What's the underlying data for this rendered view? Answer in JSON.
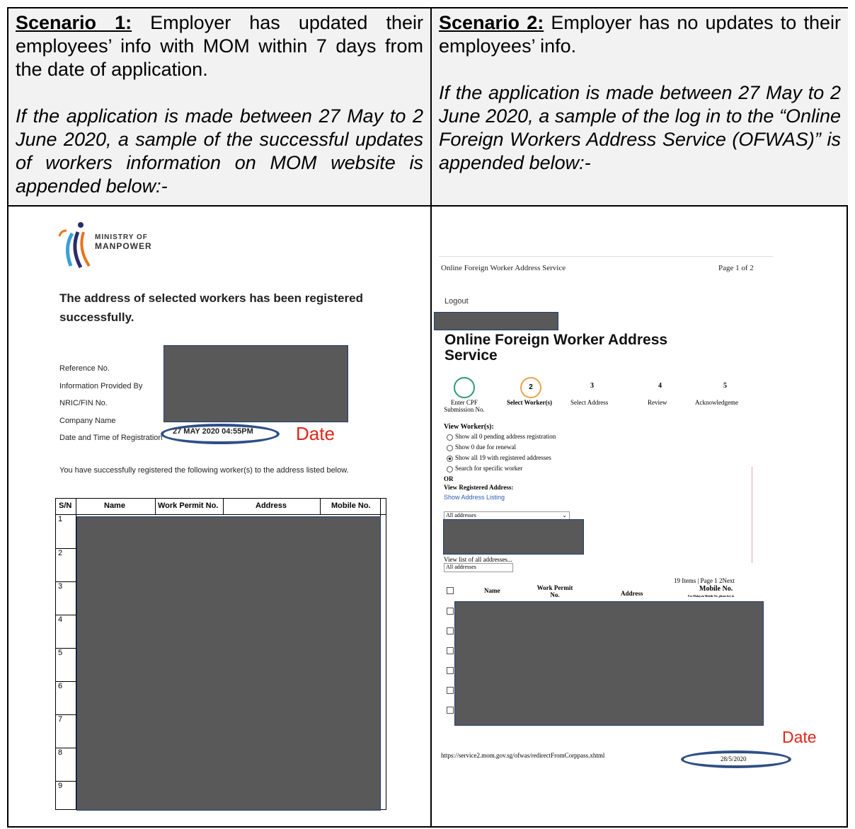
{
  "header_left": {
    "label": "Scenario 1:",
    "text": " Employer has updated their employees’ info with MOM within 7 days from the date of application.",
    "italic": "If the application is made between 27 May to 2 June 2020, a sample of the successful updates of workers information on MOM website is appended below:-"
  },
  "header_right": {
    "label": "Scenario 2:",
    "text": " Employer has no updates to their employees’ info.",
    "italic": "If the application is made between 27 May to 2 June 2020, a sample of the log in to the “Online Foreign Workers Address Service (OFWAS)” is appended below:-"
  },
  "left_panel": {
    "logo_line1": "MINISTRY OF",
    "logo_line2": "MANPOWER",
    "success_message": "The address of selected workers has been registered successfully.",
    "fields": [
      "Reference No.",
      "Information Provided By",
      "NRIC/FIN No.",
      "Company Name",
      "Date and Time of Registration"
    ],
    "registration_datetime": "27 MAY 2020 04:55PM",
    "date_annotation": "Date",
    "registered_text": "You have successfully registered the following worker(s) to the address listed below.",
    "table_headers": [
      "S/N",
      "Name",
      "Work Permit No.",
      "Address",
      "Mobile No."
    ],
    "rows": [
      "1",
      "2",
      "3",
      "4",
      "5",
      "6",
      "7",
      "8",
      "9"
    ]
  },
  "right_panel": {
    "print_header_title": "Online Foreign Worker Address Service",
    "print_page": "Page 1 of 2",
    "logout": "Logout",
    "service_title": "Online Foreign Worker Address Service",
    "steps": [
      {
        "num": "",
        "label": "Enter CPF Submission No."
      },
      {
        "num": "2",
        "label": "Select Worker(s)"
      },
      {
        "num": "3",
        "label": "Select Address"
      },
      {
        "num": "4",
        "label": "Review"
      },
      {
        "num": "5",
        "label": "Acknowledgeme"
      }
    ],
    "view_workers_label": "View Worker(s):",
    "options": [
      "Show all 0 pending address registration",
      "Show 0 due for renewal",
      "Show all 19 with registered addresses",
      "Search for specific worker"
    ],
    "selected_option": "Show all 19 with registered addresses",
    "or_label": "OR",
    "view_address_label": "View Registered Address:",
    "show_address_link": "Show Address Listing",
    "address_select": "All addresses",
    "view_list_label": "View list of all addresses...",
    "address_input": "All addresses",
    "pagination": "19 Items | Page  1  2Next",
    "table_headers": [
      "Name",
      "Work Permit No.",
      "Address",
      "Mobile No."
    ],
    "mobile_note": "For Malaysia Mobile No. please key in",
    "url": "https://service2.mom.gov.sg/ofwas/redirectFromCorppass.xhtml",
    "print_date": "28/5/2020",
    "date_annotation": "Date"
  },
  "colors": {
    "redact": "#595959",
    "annotation_red": "#e0261a",
    "oval_blue": "#2f4f86",
    "header_bg": "#f2f2f2"
  }
}
